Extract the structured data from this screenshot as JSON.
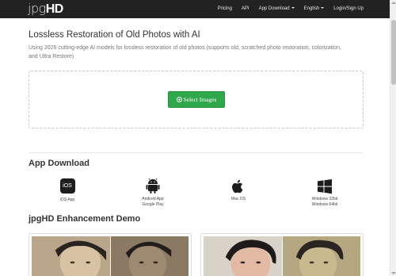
{
  "brand": {
    "part1": "jpg",
    "part2": "HD"
  },
  "nav": {
    "items": [
      "Pricing",
      "API",
      "App Download",
      "English",
      "Login/Sign Up"
    ]
  },
  "hero": {
    "title": "Lossless Restoration of Old Photos with AI",
    "subtitle": "Using 2026 cutting-edge AI models for lossless restoration of old photos (supports old, scratched photo restoration, colorization, and Ultra Restore)",
    "button_label": "Select Images"
  },
  "app_download": {
    "title": "App Download",
    "apps": [
      {
        "icon": "ios-icon",
        "badge": "iOS",
        "label_line1": "iOS App",
        "label_line2": ""
      },
      {
        "icon": "android-icon",
        "label_line1": "Android App",
        "label_line2": "Google Play"
      },
      {
        "icon": "apple-icon",
        "label_line1": "Mac OS",
        "label_line2": ""
      },
      {
        "icon": "windows-icon",
        "label_line1": "Windows 32bit",
        "label_line2": "Windows 64bit"
      }
    ]
  },
  "demo": {
    "title": "jpgHD Enhancement Demo"
  },
  "colors": {
    "navbar": "#222222",
    "button_green": "#2ea84a"
  }
}
